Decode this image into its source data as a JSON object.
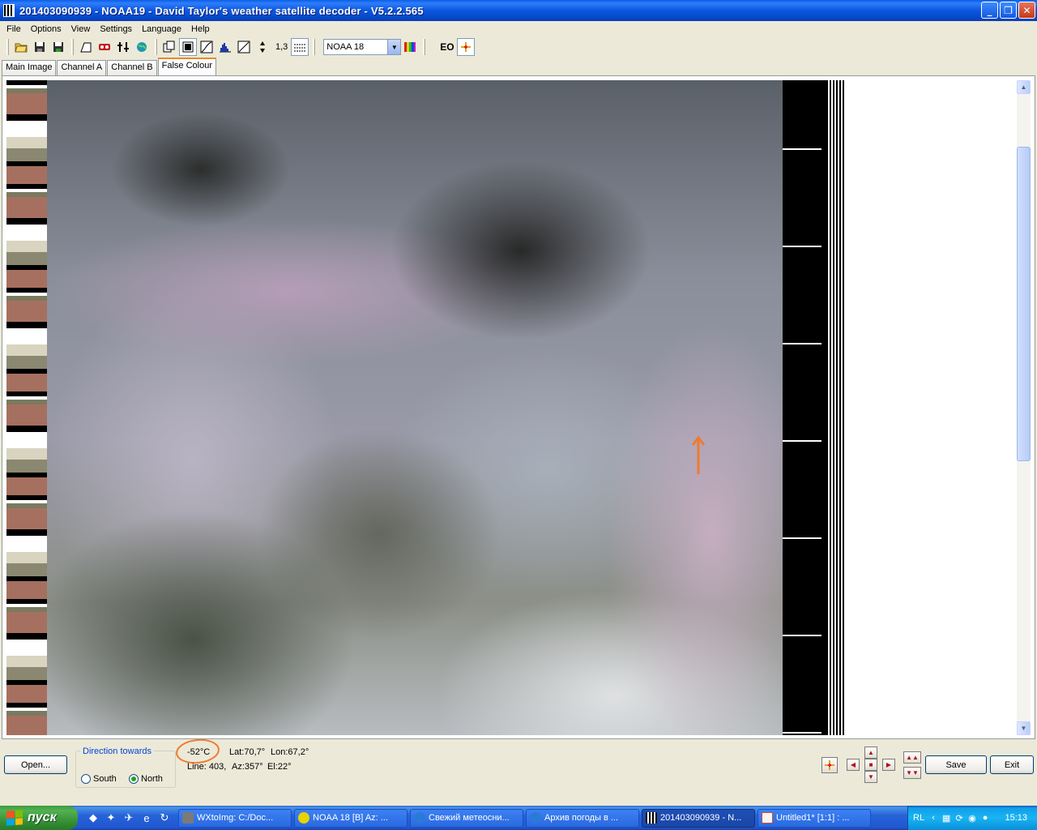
{
  "window": {
    "title": "201403090939 - NOAA19 - David Taylor's weather satellite decoder - V5.2.2.565",
    "controls": {
      "minimize": "_",
      "maximize": "❐",
      "close": "✕"
    }
  },
  "menu": [
    "File",
    "Options",
    "View",
    "Settings",
    "Language",
    "Help"
  ],
  "toolbar": {
    "icons": [
      "open-folder-icon",
      "save-icon",
      "save-as-icon",
      "crop-icon",
      "tape-icon",
      "levels-icon",
      "globe-icon"
    ],
    "zoom": "1,3",
    "satellite_select": "NOAA 18",
    "eo_label": "EO"
  },
  "tabs": [
    {
      "label": "Main Image",
      "active": false
    },
    {
      "label": "Channel A",
      "active": false
    },
    {
      "label": "Channel B",
      "active": false
    },
    {
      "label": "False Colour",
      "active": true
    }
  ],
  "image": {
    "annotation_color": "#f07a30"
  },
  "bottom": {
    "open_label": "Open...",
    "direction": {
      "title": "Direction towards",
      "south": "South",
      "north": "North",
      "selected": "North"
    },
    "temperature": "-52°C",
    "lat": "Lat:70,7°",
    "lon": "Lon:67,2°",
    "line": "Line: 403,",
    "az": "Az:357°",
    "el": "El:22°",
    "save_label": "Save",
    "exit_label": "Exit"
  },
  "taskbar": {
    "start_label": "пуск",
    "tasks": [
      {
        "label": "WXtoImg: C:/Doc...",
        "icon_color": "#7a7a7a",
        "active": false
      },
      {
        "label": "NOAA 18 [B]  Az: ...",
        "icon_color": "#e8d200",
        "active": false
      },
      {
        "label": "Свежий метеосни...",
        "icon_color": "#2a7ad8",
        "active": false
      },
      {
        "label": "Архив погоды в ...",
        "icon_color": "#2a7ad8",
        "active": false
      },
      {
        "label": "201403090939 - N...",
        "icon_color": "#e0e0e0",
        "active": true
      },
      {
        "label": "Untitled1* [1:1] : ...",
        "icon_color": "#d84a2a",
        "active": false
      }
    ],
    "tray_lang": "RL",
    "clock": "15:13"
  }
}
